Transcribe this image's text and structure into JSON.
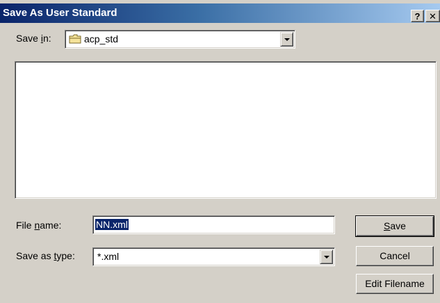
{
  "dialog": {
    "title": "Save As User Standard",
    "help_label": "?",
    "close_label": "✕"
  },
  "save_in": {
    "label_pre": "Save ",
    "label_accel": "i",
    "label_post": "n:",
    "value": "acp_std",
    "icon": "folder-icon"
  },
  "file_list": {
    "items": []
  },
  "file_name": {
    "label_pre": "File ",
    "label_accel": "n",
    "label_post": "ame:",
    "value": "NN.xml"
  },
  "save_as_type": {
    "label_pre": "Save as ",
    "label_accel": "t",
    "label_post": "ype:",
    "value": "*.xml"
  },
  "buttons": {
    "save_accel": "S",
    "save_post": "ave",
    "cancel": "Cancel",
    "edit_filename": "Edit Filename"
  },
  "colors": {
    "titlebar_start": "#0a246a",
    "titlebar_end": "#a6caf0",
    "selection": "#0a246a",
    "face": "#d4d0c8"
  }
}
